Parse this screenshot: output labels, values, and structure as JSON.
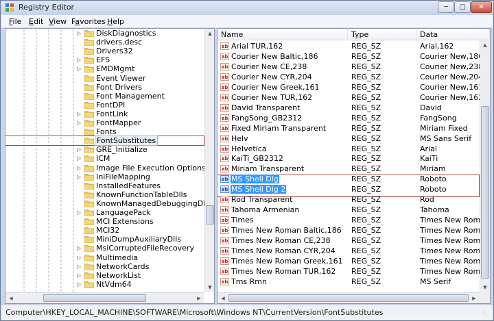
{
  "window": {
    "title": "Registry Editor"
  },
  "menu": [
    {
      "mnemonic": "F",
      "rest": "ile"
    },
    {
      "mnemonic": "E",
      "rest": "dit"
    },
    {
      "mnemonic": "V",
      "rest": "iew"
    },
    {
      "pre": "F",
      "mnemonic": "a",
      "rest": "vorites"
    },
    {
      "mnemonic": "H",
      "rest": "elp"
    }
  ],
  "tree": [
    {
      "label": "DiskDiagnostics",
      "expandable": true
    },
    {
      "label": "drivers.desc",
      "expandable": false
    },
    {
      "label": "Drivers32",
      "expandable": false
    },
    {
      "label": "EFS",
      "expandable": true
    },
    {
      "label": "EMDMgmt",
      "expandable": true
    },
    {
      "label": "Event Viewer",
      "expandable": false
    },
    {
      "label": "Font Drivers",
      "expandable": false
    },
    {
      "label": "Font Management",
      "expandable": false
    },
    {
      "label": "FontDPI",
      "expandable": false
    },
    {
      "label": "FontLink",
      "expandable": true
    },
    {
      "label": "FontMapper",
      "expandable": true
    },
    {
      "label": "Fonts",
      "expandable": false
    },
    {
      "label": "FontSubstitutes",
      "expandable": false,
      "selected": true
    },
    {
      "label": "GRE_Initialize",
      "expandable": true
    },
    {
      "label": "ICM",
      "expandable": true
    },
    {
      "label": "Image File Execution Options",
      "expandable": true
    },
    {
      "label": "IniFileMapping",
      "expandable": true
    },
    {
      "label": "InstalledFeatures",
      "expandable": false
    },
    {
      "label": "KnownFunctionTableDlls",
      "expandable": false
    },
    {
      "label": "KnownManagedDebuggingDlls",
      "expandable": false
    },
    {
      "label": "LanguagePack",
      "expandable": true
    },
    {
      "label": "MCI Extensions",
      "expandable": false
    },
    {
      "label": "MCI32",
      "expandable": false
    },
    {
      "label": "MiniDumpAuxiliaryDlls",
      "expandable": false
    },
    {
      "label": "MsiCorruptedFileRecovery",
      "expandable": true
    },
    {
      "label": "Multimedia",
      "expandable": true
    },
    {
      "label": "NetworkCards",
      "expandable": true
    },
    {
      "label": "NetworkList",
      "expandable": true
    },
    {
      "label": "NtVdm64",
      "expandable": true
    }
  ],
  "columns": {
    "name": "Name",
    "type": "Type",
    "data": "Data"
  },
  "values": [
    {
      "name": "Arial TUR,162",
      "type": "REG_SZ",
      "data": "Arial,162"
    },
    {
      "name": "Courier New Baltic,186",
      "type": "REG_SZ",
      "data": "Courier New,186"
    },
    {
      "name": "Courier New CE,238",
      "type": "REG_SZ",
      "data": "Courier New,238"
    },
    {
      "name": "Courier New CYR,204",
      "type": "REG_SZ",
      "data": "Courier New,204"
    },
    {
      "name": "Courier New Greek,161",
      "type": "REG_SZ",
      "data": "Courier New,161"
    },
    {
      "name": "Courier New TUR,162",
      "type": "REG_SZ",
      "data": "Courier New,162"
    },
    {
      "name": "David Transparent",
      "type": "REG_SZ",
      "data": "David"
    },
    {
      "name": "FangSong_GB2312",
      "type": "REG_SZ",
      "data": "FangSong"
    },
    {
      "name": "Fixed Miriam Transparent",
      "type": "REG_SZ",
      "data": "Miriam Fixed"
    },
    {
      "name": "Helv",
      "type": "REG_SZ",
      "data": "MS Sans Serif"
    },
    {
      "name": "Helvetica",
      "type": "REG_SZ",
      "data": "Arial"
    },
    {
      "name": "KaiTi_GB2312",
      "type": "REG_SZ",
      "data": "KaiTi"
    },
    {
      "name": "Miriam Transparent",
      "type": "REG_SZ",
      "data": "Miriam"
    },
    {
      "name": "MS Shell Dlg",
      "type": "REG_SZ",
      "data": "Roboto",
      "selected": true
    },
    {
      "name": "MS Shell Dlg 2",
      "type": "REG_SZ",
      "data": "Roboto",
      "selected": true
    },
    {
      "name": "Rod Transparent",
      "type": "REG_SZ",
      "data": "Rod"
    },
    {
      "name": "Tahoma Armenian",
      "type": "REG_SZ",
      "data": "Tahoma"
    },
    {
      "name": "Times",
      "type": "REG_SZ",
      "data": "Times New Roman"
    },
    {
      "name": "Times New Roman Baltic,186",
      "type": "REG_SZ",
      "data": "Times New Roman,"
    },
    {
      "name": "Times New Roman CE,238",
      "type": "REG_SZ",
      "data": "Times New Roman,"
    },
    {
      "name": "Times New Roman CYR,204",
      "type": "REG_SZ",
      "data": "Times New Roman,"
    },
    {
      "name": "Times New Roman Greek,161",
      "type": "REG_SZ",
      "data": "Times New Roman,"
    },
    {
      "name": "Times New Roman TUR,162",
      "type": "REG_SZ",
      "data": "Times New Roman,"
    },
    {
      "name": "Tms Rmn",
      "type": "REG_SZ",
      "data": "MS Serif"
    }
  ],
  "status": {
    "path": "Computer\\HKEY_LOCAL_MACHINE\\SOFTWARE\\Microsoft\\Windows NT\\CurrentVersion\\FontSubstitutes"
  },
  "icons": {
    "app": "registry-editor-icon",
    "folder": "folder-icon",
    "value": "string-value-ab-icon",
    "expand": "expand-arrow-icon"
  },
  "colors": {
    "selection": "#3399ff",
    "folder": "#e8c15a",
    "highlight_box": "#aa4444"
  }
}
